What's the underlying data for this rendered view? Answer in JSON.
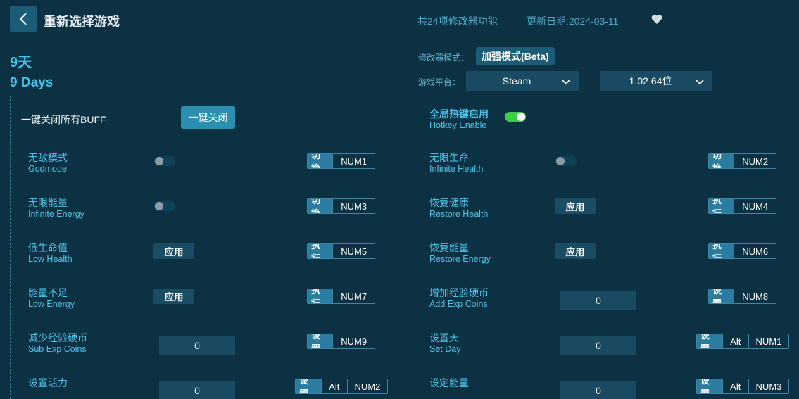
{
  "header": {
    "back_icon": "chevron-left-icon",
    "title": "重新选择游戏",
    "feature_count": "共24项修改器功能",
    "update_date": "更新日期:2024-03-11",
    "favorite_icon": "heart-icon"
  },
  "game": {
    "name_cn": "9天",
    "name_en": "9 Days"
  },
  "settings": {
    "mode_label": "修改器模式：",
    "mode_value": "加强模式(Beta)",
    "platform_label": "游戏平台：",
    "platform_value": "Steam",
    "version_value": "1.02 64位"
  },
  "global": {
    "close_all_label": "一键关闭所有BUFF",
    "close_all_button": "一键关闭",
    "hotkey_cn": "全局热键启用",
    "hotkey_en": "Hotkey Enable",
    "hotkey_enabled": true
  },
  "cheats": [
    {
      "cn": "无敌模式",
      "en": "Godmode",
      "control": "toggle",
      "action": "切换",
      "keys": [
        "NUM1"
      ]
    },
    {
      "cn": "无限生命",
      "en": "Infinite Health",
      "control": "toggle",
      "action": "切换",
      "keys": [
        "NUM2"
      ]
    },
    {
      "cn": "无限能量",
      "en": "Infinite Energy",
      "control": "toggle",
      "action": "切换",
      "keys": [
        "NUM3"
      ]
    },
    {
      "cn": "恢复健康",
      "en": "Restore Health",
      "control": "apply",
      "button": "应用",
      "action": "执行",
      "keys": [
        "NUM4"
      ]
    },
    {
      "cn": "低生命值",
      "en": "Low Health",
      "control": "apply",
      "button": "应用",
      "action": "执行",
      "keys": [
        "NUM5"
      ]
    },
    {
      "cn": "恢复能量",
      "en": "Restore Energy",
      "control": "apply",
      "button": "应用",
      "action": "执行",
      "keys": [
        "NUM6"
      ]
    },
    {
      "cn": "能量不足",
      "en": "Low Energy",
      "control": "apply",
      "button": "应用",
      "action": "执行",
      "keys": [
        "NUM7"
      ]
    },
    {
      "cn": "增加经验硬币",
      "en": "Add Exp Coins",
      "control": "input",
      "value": "0",
      "action": "设置",
      "keys": [
        "NUM8"
      ]
    },
    {
      "cn": "减少经验硬币",
      "en": "Sub Exp Coins",
      "control": "input",
      "value": "0",
      "action": "设置",
      "keys": [
        "NUM9"
      ]
    },
    {
      "cn": "设置天",
      "en": "Set Day",
      "control": "input",
      "value": "0",
      "action": "设置",
      "keys": [
        "Alt",
        "NUM1"
      ]
    },
    {
      "cn": "设置活力",
      "en": "",
      "control": "input",
      "value": "0",
      "action": "设置",
      "keys": [
        "Alt",
        "NUM2"
      ]
    },
    {
      "cn": "设定能量",
      "en": "",
      "control": "input",
      "value": "0",
      "action": "设置",
      "keys": [
        "Alt",
        "NUM3"
      ]
    }
  ]
}
